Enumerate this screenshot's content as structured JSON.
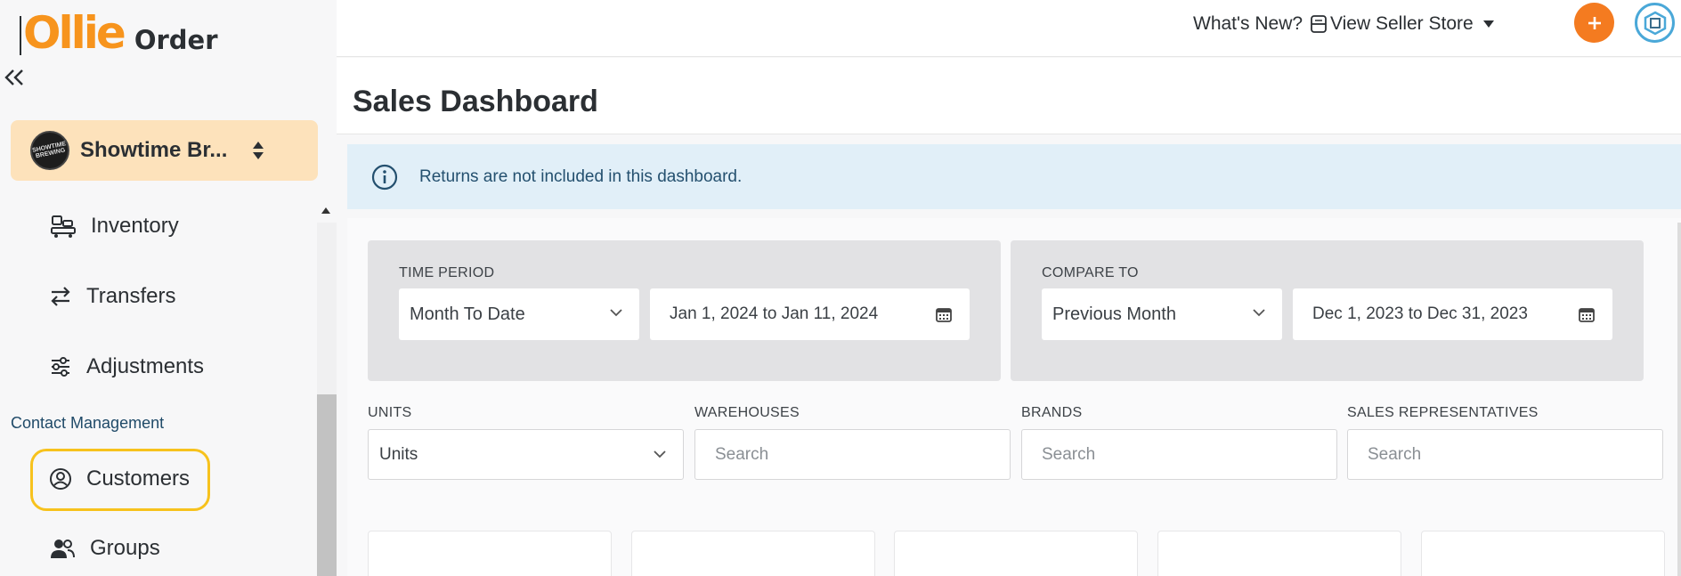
{
  "brand": {
    "logo_main": "Ollie",
    "logo_sub": "Order",
    "accent": "#f7941d"
  },
  "sidebar": {
    "store": {
      "name": "Showtime Br...",
      "avatar_text": "SHOWTIME BREWING"
    },
    "items": [
      {
        "label": "Inventory",
        "icon": "inventory-icon"
      },
      {
        "label": "Transfers",
        "icon": "transfers-icon"
      },
      {
        "label": "Adjustments",
        "icon": "sliders-icon"
      }
    ],
    "section": "Contact Management",
    "contact_items": [
      {
        "label": "Customers",
        "icon": "user-circle-icon",
        "highlighted": true
      },
      {
        "label": "Groups",
        "icon": "users-icon"
      }
    ]
  },
  "topbar": {
    "whats_new": "What's New?",
    "view_seller_store": "View Seller Store",
    "add_color": "#f47b20"
  },
  "page": {
    "title": "Sales Dashboard",
    "info": "Returns are not included in this dashboard."
  },
  "filters": {
    "time_period": {
      "label": "TIME PERIOD",
      "selected": "Month To Date",
      "range": "Jan 1, 2024 to Jan 11, 2024"
    },
    "compare_to": {
      "label": "COMPARE TO",
      "selected": "Previous Month",
      "range": "Dec 1, 2023 to Dec 31, 2023"
    },
    "units": {
      "label": "UNITS",
      "selected": "Units"
    },
    "warehouses": {
      "label": "WAREHOUSES",
      "placeholder": "Search"
    },
    "brands": {
      "label": "BRANDS",
      "placeholder": "Search"
    },
    "sales_reps": {
      "label": "SALES REPRESENTATIVES",
      "placeholder": "Search"
    }
  }
}
